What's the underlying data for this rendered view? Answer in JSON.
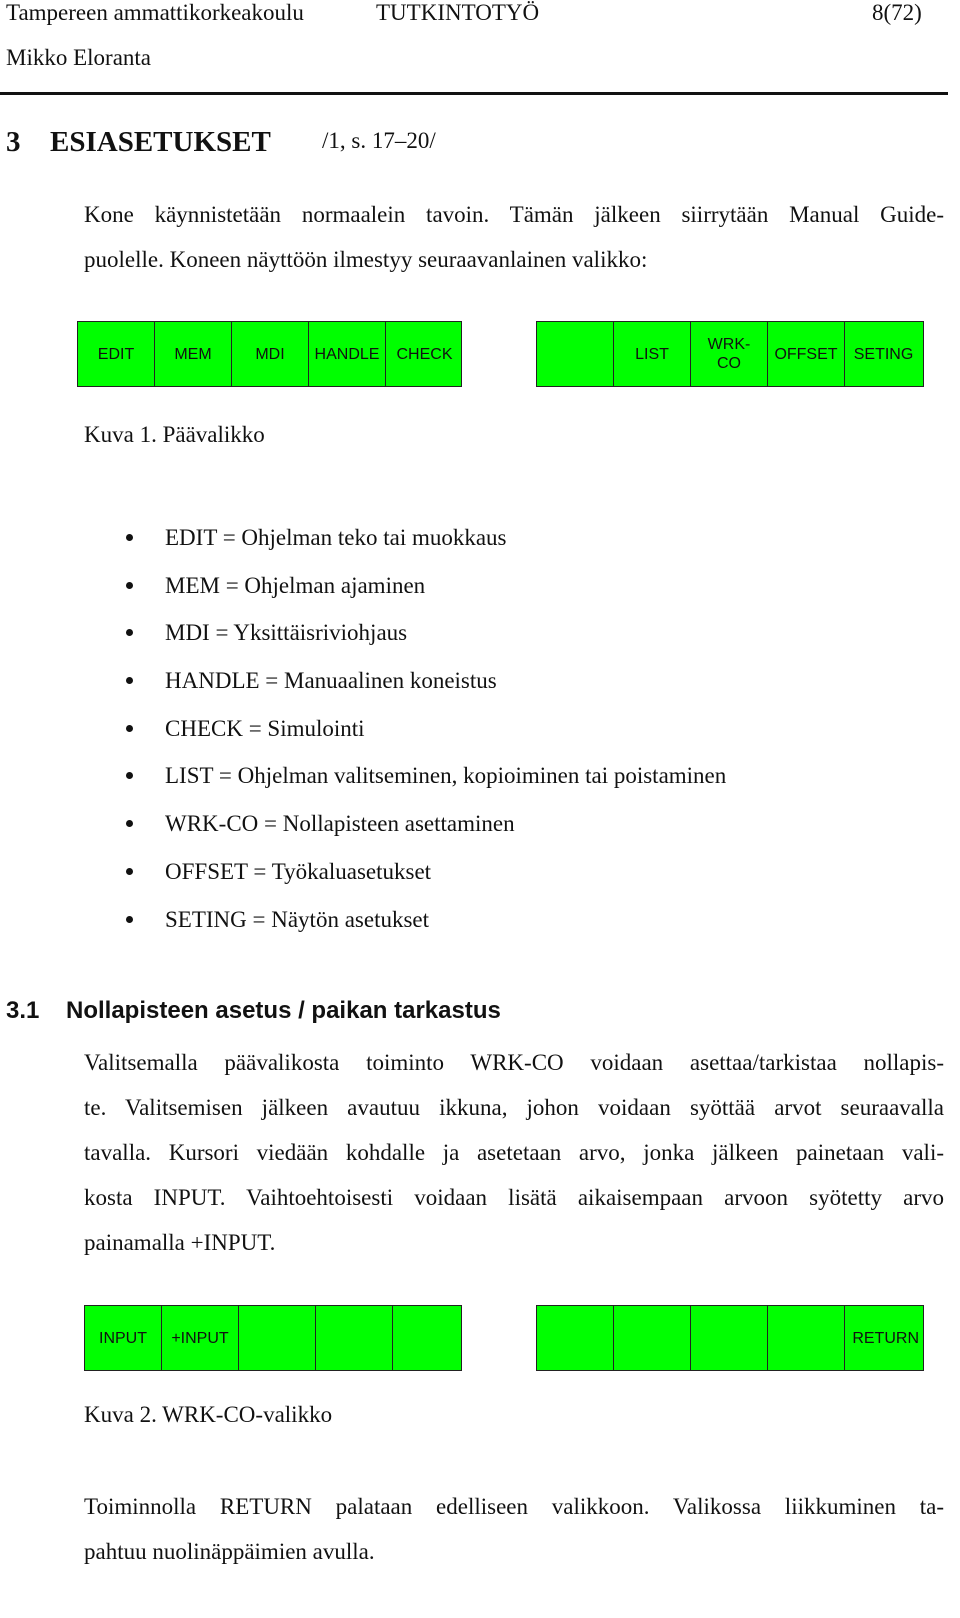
{
  "header": {
    "institution": "Tampereen ammattikorkeakoulu",
    "doc_type": "TUTKINTOTYÖ",
    "page": "8(72)",
    "author": "Mikko Eloranta"
  },
  "section3": {
    "number": "3",
    "title": "ESIASETUKSET",
    "reference": "/1, s. 17–20/",
    "intro_lines": [
      "Kone käynnistetään normaalein tavoin. Tämän jälkeen siirrytään Manual Guide-",
      "puolelle. Koneen näyttöön ilmestyy seuraavanlainen valikko:"
    ]
  },
  "figure1": {
    "left_keys": [
      "EDIT",
      "MEM",
      "MDI",
      "HANDLE",
      "CHECK"
    ],
    "right_keys": [
      "",
      "LIST",
      "WRK-CO",
      "OFFSET",
      "SETING"
    ],
    "key_color": "#00ff00",
    "caption": "Kuva 1. Päävalikko"
  },
  "definitions": [
    "EDIT = Ohjelman teko tai muokkaus",
    "MEM = Ohjelman ajaminen",
    "MDI = Yksittäisriviohjaus",
    "HANDLE = Manuaalinen koneistus",
    "CHECK = Simulointi",
    "LIST = Ohjelman valitseminen, kopioiminen tai poistaminen",
    "WRK-CO = Nollapisteen asettaminen",
    "OFFSET = Työkaluasetukset",
    "SETING = Näytön asetukset"
  ],
  "section3_1": {
    "number": "3.1",
    "title": "Nollapisteen asetus / paikan tarkastus",
    "body_lines": [
      "Valitsemalla päävalikosta toiminto WRK-CO voidaan asettaa/tarkistaa nollapis-",
      "te. Valitsemisen jälkeen avautuu ikkuna, johon voidaan syöttää arvot seuraavalla",
      "tavalla. Kursori viedään kohdalle ja asetetaan arvo, jonka jälkeen painetaan vali-",
      "kosta INPUT. Vaihtoehtoisesti voidaan lisätä aikaisempaan arvoon syötetty arvo",
      "painamalla +INPUT."
    ]
  },
  "figure2": {
    "left_keys": [
      "INPUT",
      "+INPUT",
      "",
      "",
      ""
    ],
    "right_keys": [
      "",
      "",
      "",
      "",
      "RETURN"
    ],
    "caption": "Kuva 2. WRK-CO-valikko"
  },
  "closing_lines": [
    "Toiminnolla RETURN palataan edelliseen valikkoon. Valikossa liikkuminen ta-",
    "pahtuu nuolinäppäimien avulla."
  ]
}
